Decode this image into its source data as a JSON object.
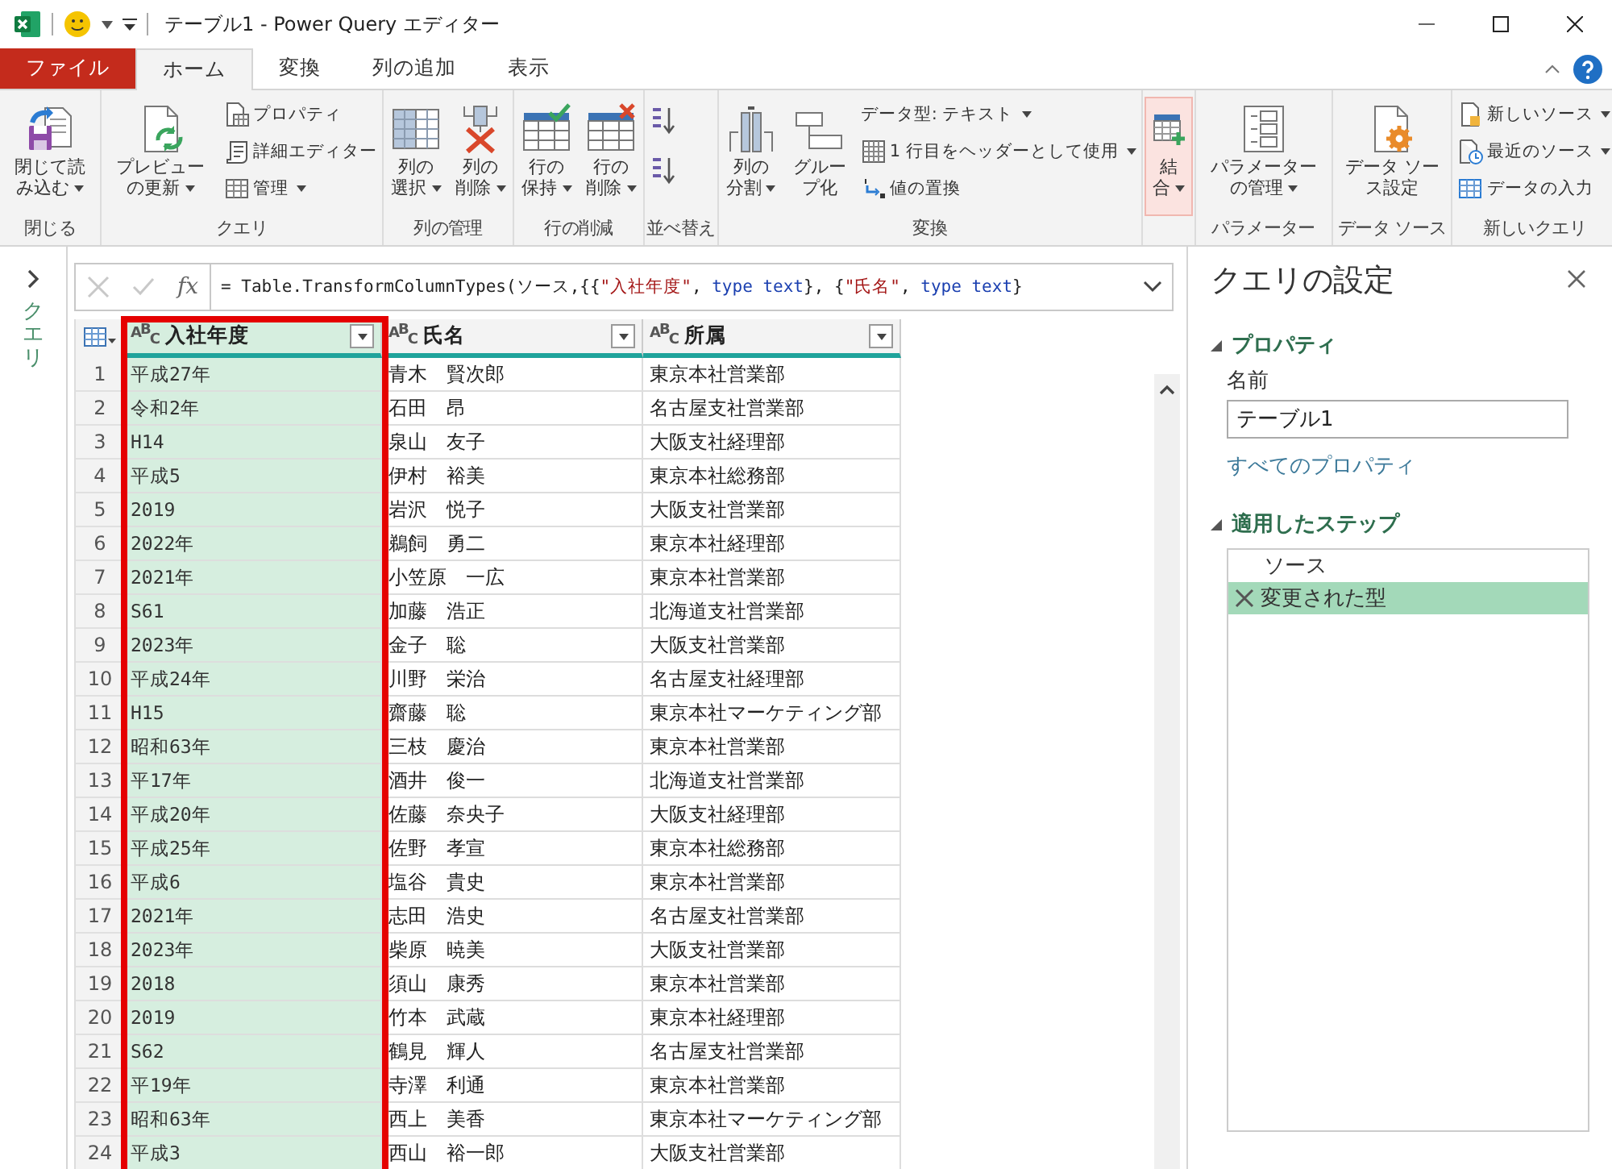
{
  "window": {
    "title": "テーブル1 - Power Query エディター"
  },
  "tabs": [
    {
      "label": "ファイル",
      "kind": "file",
      "selected": false
    },
    {
      "label": "ホーム",
      "kind": "tab",
      "selected": true
    },
    {
      "label": "変換",
      "kind": "tab",
      "selected": false
    },
    {
      "label": "列の追加",
      "kind": "tab",
      "selected": false
    },
    {
      "label": "表示",
      "kind": "tab",
      "selected": false
    }
  ],
  "ribbon_groups": [
    {
      "label": "閉じる",
      "items": [
        {
          "kind": "large",
          "label": "閉じて読み込む",
          "dropdown": true,
          "selected": false
        }
      ]
    },
    {
      "label": "クエリ",
      "items": [
        {
          "kind": "large",
          "label": "プレビューの更新",
          "dropdown": true,
          "selected": false
        },
        {
          "kind": "small",
          "label": "プロパティ",
          "dropdown": false,
          "selected": false
        },
        {
          "kind": "small",
          "label": "詳細エディター",
          "dropdown": false,
          "selected": false
        },
        {
          "kind": "small",
          "label": "管理",
          "dropdown": true,
          "selected": false
        }
      ]
    },
    {
      "label": "列の管理",
      "items": [
        {
          "kind": "large",
          "label": "列の選択",
          "dropdown": true,
          "selected": false
        },
        {
          "kind": "large",
          "label": "列の削除",
          "dropdown": true,
          "selected": false
        }
      ]
    },
    {
      "label": "行の削減",
      "items": [
        {
          "kind": "large",
          "label": "行の保持",
          "dropdown": true,
          "selected": false
        },
        {
          "kind": "large",
          "label": "行の削除",
          "dropdown": true,
          "selected": false
        }
      ]
    },
    {
      "label": "並べ替え",
      "items": [
        {
          "kind": "icon",
          "dropdown": false,
          "selected": false
        },
        {
          "kind": "icon",
          "dropdown": false,
          "selected": false
        }
      ]
    },
    {
      "label": "変換",
      "items": [
        {
          "kind": "large",
          "label": "列の分割",
          "dropdown": true,
          "selected": false
        },
        {
          "kind": "large",
          "label": "グループ化",
          "dropdown": false,
          "selected": false
        },
        {
          "kind": "small",
          "label": "データ型: テキスト",
          "dropdown": true,
          "selected": false
        },
        {
          "kind": "small",
          "label": "1 行目をヘッダーとして使用",
          "dropdown": true,
          "selected": false
        },
        {
          "kind": "small",
          "label": "値の置換",
          "dropdown": false,
          "selected": false
        }
      ]
    },
    {
      "items": [
        {
          "kind": "large",
          "label": "結合",
          "dropdown": true,
          "selected": true
        }
      ]
    },
    {
      "label": "パラメーター",
      "items": [
        {
          "kind": "large",
          "label": "パラメーターの管理",
          "dropdown": true,
          "selected": false
        }
      ]
    },
    {
      "label": "データ ソース",
      "items": [
        {
          "kind": "large",
          "label": "データ ソース設定",
          "dropdown": false,
          "selected": false
        }
      ]
    },
    {
      "label": "新しいクエリ",
      "items": [
        {
          "kind": "small",
          "label": "新しいソース",
          "dropdown": true,
          "selected": false
        },
        {
          "kind": "small",
          "label": "最近のソース",
          "dropdown": true,
          "selected": false
        },
        {
          "kind": "small",
          "label": "データの入力",
          "dropdown": false,
          "selected": false
        }
      ]
    }
  ],
  "queries_pane": {
    "label": "クエリ",
    "expanded": false
  },
  "formula_bar": {
    "function_label": "fx",
    "tokens": [
      {
        "kind": "plain",
        "text": "= Table.TransformColumnTypes(ソース,{{"
      },
      {
        "kind": "string",
        "text": "\"入社年度\""
      },
      {
        "kind": "plain",
        "text": ", "
      },
      {
        "kind": "keyword",
        "text": "type text"
      },
      {
        "kind": "plain",
        "text": "}, {"
      },
      {
        "kind": "string",
        "text": "\"氏名\""
      },
      {
        "kind": "plain",
        "text": ", "
      },
      {
        "kind": "keyword",
        "text": "type text"
      },
      {
        "kind": "plain",
        "text": "}"
      }
    ]
  },
  "table": {
    "columns": [
      {
        "name": "入社年度",
        "type_label": "ABC",
        "selected": true,
        "framed": true
      },
      {
        "name": "氏名",
        "type_label": "ABC",
        "selected": false,
        "framed": false
      },
      {
        "name": "所属",
        "type_label": "ABC",
        "selected": false,
        "framed": false
      }
    ],
    "rows": [
      {
        "number": "1",
        "cells": [
          "平成27年",
          "青木　賢次郎",
          "東京本社営業部"
        ]
      },
      {
        "number": "2",
        "cells": [
          "令和2年",
          "石田　昂",
          "名古屋支社営業部"
        ]
      },
      {
        "number": "3",
        "cells": [
          "H14",
          "泉山　友子",
          "大阪支社経理部"
        ]
      },
      {
        "number": "4",
        "cells": [
          "平成5",
          "伊村　裕美",
          "東京本社総務部"
        ]
      },
      {
        "number": "5",
        "cells": [
          "2019",
          "岩沢　悦子",
          "大阪支社営業部"
        ]
      },
      {
        "number": "6",
        "cells": [
          "2022年",
          "鵜飼　勇二",
          "東京本社経理部"
        ]
      },
      {
        "number": "7",
        "cells": [
          "2021年",
          "小笠原　一広",
          "東京本社営業部"
        ]
      },
      {
        "number": "8",
        "cells": [
          "S61",
          "加藤　浩正",
          "北海道支社営業部"
        ]
      },
      {
        "number": "9",
        "cells": [
          "2023年",
          "金子　聡",
          "大阪支社営業部"
        ]
      },
      {
        "number": "10",
        "cells": [
          "平成24年",
          "川野　栄治",
          "名古屋支社経理部"
        ]
      },
      {
        "number": "11",
        "cells": [
          "H15",
          "齋藤　聡",
          "東京本社マーケティング部"
        ]
      },
      {
        "number": "12",
        "cells": [
          "昭和63年",
          "三枝　慶治",
          "東京本社営業部"
        ]
      },
      {
        "number": "13",
        "cells": [
          "平17年",
          "酒井　俊一",
          "北海道支社営業部"
        ]
      },
      {
        "number": "14",
        "cells": [
          "平成20年",
          "佐藤　奈央子",
          "大阪支社経理部"
        ]
      },
      {
        "number": "15",
        "cells": [
          "平成25年",
          "佐野　孝宣",
          "東京本社総務部"
        ]
      },
      {
        "number": "16",
        "cells": [
          "平成6",
          "塩谷　貴史",
          "東京本社営業部"
        ]
      },
      {
        "number": "17",
        "cells": [
          "2021年",
          "志田　浩史",
          "名古屋支社営業部"
        ]
      },
      {
        "number": "18",
        "cells": [
          "2023年",
          "柴原　暁美",
          "大阪支社営業部"
        ]
      },
      {
        "number": "19",
        "cells": [
          "2018",
          "須山　康秀",
          "東京本社営業部"
        ]
      },
      {
        "number": "20",
        "cells": [
          "2019",
          "竹本　武蔵",
          "東京本社経理部"
        ]
      },
      {
        "number": "21",
        "cells": [
          "S62",
          "鶴見　輝人",
          "名古屋支社営業部"
        ]
      },
      {
        "number": "22",
        "cells": [
          "平19年",
          "寺澤　利通",
          "東京本社営業部"
        ]
      },
      {
        "number": "23",
        "cells": [
          "昭和63年",
          "西上　美香",
          "東京本社マーケティング部"
        ]
      },
      {
        "number": "24",
        "cells": [
          "平成3",
          "西山　裕一郎",
          "大阪支社営業部"
        ]
      }
    ]
  },
  "settings": {
    "title": "クエリの設定",
    "sections": [
      {
        "title": "プロパティ",
        "expanded": true
      },
      {
        "title": "適用したステップ",
        "expanded": true
      }
    ],
    "name_label": "名前",
    "name_value": "テーブル1",
    "all_properties_link": "すべてのプロパティ",
    "steps": [
      {
        "label": "ソース",
        "selected": false
      },
      {
        "label": "変更された型",
        "selected": true
      }
    ]
  }
}
